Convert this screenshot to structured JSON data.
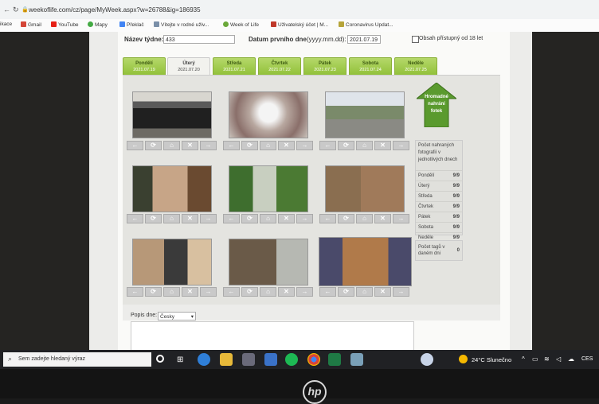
{
  "browser": {
    "url": "weekoflife.com/cz/page/MyWeek.aspx?w=26788&ig=186935",
    "bookmarks": [
      "ikace",
      "Gmail",
      "YouTube",
      "Mapy",
      "Překlač",
      "Vítejte v rodné uživ...",
      "Week of Life",
      "Uživatelský účet | M...",
      "Coronavirus Updat..."
    ]
  },
  "form": {
    "week_name_label": "Název týdne:",
    "week_name_value": "433",
    "first_day_label": "Datum prvního dne",
    "first_day_hint": "(yyyy.mm.dd):",
    "first_day_value": "2021.07.19",
    "adult_label": "Obsah přístupný od 18 let"
  },
  "tabs": [
    {
      "name": "Pondělí",
      "date": "2021.07.19"
    },
    {
      "name": "Úterý",
      "date": "2021.07.20"
    },
    {
      "name": "Středa",
      "date": "2021.07.21"
    },
    {
      "name": "Čtvrtek",
      "date": "2021.07.22"
    },
    {
      "name": "Pátek",
      "date": "2021.07.23"
    },
    {
      "name": "Sobota",
      "date": "2021.07.24"
    },
    {
      "name": "Neděle",
      "date": "2021.07.25"
    }
  ],
  "controls": [
    "←",
    "⟳",
    "⌂",
    "✕",
    "→"
  ],
  "upload": {
    "line1": "Hromadné",
    "line2": "nahrání",
    "line3": "fotek"
  },
  "counts": {
    "heading": "Počet nahraných fotografií v jednotlivých dnech",
    "rows": [
      {
        "day": "Pondělí",
        "val": "9/9"
      },
      {
        "day": "Úterý",
        "val": "9/9"
      },
      {
        "day": "Středa",
        "val": "9/9"
      },
      {
        "day": "Čtvrtek",
        "val": "9/9"
      },
      {
        "day": "Pátek",
        "val": "9/9"
      },
      {
        "day": "Sobota",
        "val": "9/9"
      },
      {
        "day": "Neděle",
        "val": "9/9"
      }
    ]
  },
  "tags": {
    "label": "Počet tagů v daném dni",
    "value": "0"
  },
  "description": {
    "label": "Popis dne:",
    "language": "Česky"
  },
  "taskbar": {
    "search_placeholder": "Sem zadejte hledaný výraz",
    "weather": "24°C Slunečno",
    "lang": "CES"
  },
  "colors": {
    "tab_green": "#9cc845",
    "upload_green": "#5a9a2e",
    "taskbar": "#202124"
  }
}
